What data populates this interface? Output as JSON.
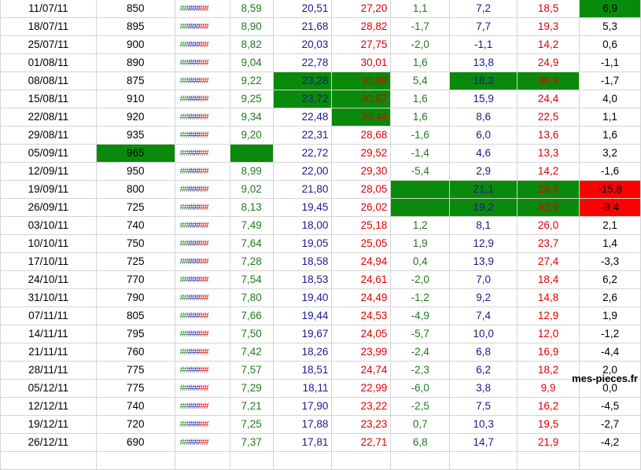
{
  "rows": [
    {
      "date": "11/07/11",
      "val": "850",
      "a": "8,59",
      "b": "20,51",
      "c": "27,20",
      "d": "1,1",
      "e": "7,2",
      "f": "18,5",
      "g": "6,9",
      "hl": {
        "g": "green"
      }
    },
    {
      "date": "18/07/11",
      "val": "895",
      "a": "8,90",
      "b": "21,68",
      "c": "28,82",
      "d": "-1,7",
      "e": "7,7",
      "f": "19,3",
      "g": "5,3",
      "hl": {}
    },
    {
      "date": "25/07/11",
      "val": "900",
      "a": "8,82",
      "b": "20,03",
      "c": "27,75",
      "d": "-2,0",
      "e": "-1,1",
      "f": "14,2",
      "g": "0,6",
      "hl": {}
    },
    {
      "date": "01/08/11",
      "val": "890",
      "a": "9,04",
      "b": "22,78",
      "c": "30,01",
      "d": "1,6",
      "e": "13,8",
      "f": "24,9",
      "g": "-1,1",
      "hl": {}
    },
    {
      "date": "08/08/11",
      "val": "875",
      "a": "9,22",
      "b": "23,28",
      "c": "30,93",
      "d": "5,4",
      "e": "18,3",
      "f": "30,9",
      "g": "-1,7",
      "hl": {
        "b": "green",
        "c": "green",
        "e": "green",
        "f": "green"
      }
    },
    {
      "date": "15/08/11",
      "val": "910",
      "a": "9,25",
      "b": "23,72",
      "c": "30,57",
      "d": "1,6",
      "e": "15,9",
      "f": "24,4",
      "g": "4,0",
      "hl": {
        "b": "green",
        "c": "green"
      }
    },
    {
      "date": "22/08/11",
      "val": "920",
      "a": "9,34",
      "b": "22,48",
      "c": "30,44",
      "d": "1,6",
      "e": "8,6",
      "f": "22,5",
      "g": "1,1",
      "hl": {
        "c": "green"
      }
    },
    {
      "date": "29/08/11",
      "val": "935",
      "a": "9,20",
      "b": "22,31",
      "c": "28,68",
      "d": "-1,6",
      "e": "6,0",
      "f": "13,6",
      "g": "1,6",
      "hl": {}
    },
    {
      "date": "05/09/11",
      "val": "965",
      "a": "9,51",
      "b": "22,72",
      "c": "29,52",
      "d": "-1,4",
      "e": "4,6",
      "f": "13,3",
      "g": "3,2",
      "hl": {
        "val": "green",
        "a": "green"
      }
    },
    {
      "date": "12/09/11",
      "val": "950",
      "a": "8,99",
      "b": "22,00",
      "c": "29,30",
      "d": "-5,4",
      "e": "2,9",
      "f": "14,2",
      "g": "-1,6",
      "hl": {}
    },
    {
      "date": "19/09/11",
      "val": "800",
      "a": "9,02",
      "b": "21,80",
      "c": "28,05",
      "d": "12,7",
      "e": "21,1",
      "f": "29,9",
      "g": "-15,8",
      "hl": {
        "d": "green",
        "e": "green",
        "f": "green",
        "g": "red"
      }
    },
    {
      "date": "26/09/11",
      "val": "725",
      "a": "8,13",
      "b": "19,45",
      "c": "26,02",
      "d": "12,1",
      "e": "19,2",
      "f": "32,9",
      "g": "-9,4",
      "hl": {
        "d": "green",
        "e": "green",
        "f": "green",
        "g": "red"
      }
    },
    {
      "date": "03/10/11",
      "val": "740",
      "a": "7,49",
      "b": "18,00",
      "c": "25,18",
      "d": "1,2",
      "e": "8,1",
      "f": "26,0",
      "g": "2,1",
      "hl": {}
    },
    {
      "date": "10/10/11",
      "val": "750",
      "a": "7,64",
      "b": "19,05",
      "c": "25,05",
      "d": "1,9",
      "e": "12,9",
      "f": "23,7",
      "g": "1,4",
      "hl": {}
    },
    {
      "date": "17/10/11",
      "val": "725",
      "a": "7,28",
      "b": "18,58",
      "c": "24,94",
      "d": "0,4",
      "e": "13,9",
      "f": "27,4",
      "g": "-3,3",
      "hl": {}
    },
    {
      "date": "24/10/11",
      "val": "770",
      "a": "7,54",
      "b": "18,53",
      "c": "24,61",
      "d": "-2,0",
      "e": "7,0",
      "f": "18,4",
      "g": "6,2",
      "hl": {}
    },
    {
      "date": "31/10/11",
      "val": "790",
      "a": "7,80",
      "b": "19,40",
      "c": "24,49",
      "d": "-1,2",
      "e": "9,2",
      "f": "14,8",
      "g": "2,6",
      "hl": {}
    },
    {
      "date": "07/11/11",
      "val": "805",
      "a": "7,66",
      "b": "19,44",
      "c": "24,53",
      "d": "-4,9",
      "e": "7,4",
      "f": "12,9",
      "g": "1,9",
      "hl": {}
    },
    {
      "date": "14/11/11",
      "val": "795",
      "a": "7,50",
      "b": "19,67",
      "c": "24,05",
      "d": "-5,7",
      "e": "10,0",
      "f": "12,0",
      "g": "-1,2",
      "hl": {}
    },
    {
      "date": "21/11/11",
      "val": "760",
      "a": "7,42",
      "b": "18,26",
      "c": "23,99",
      "d": "-2,4",
      "e": "6,8",
      "f": "16,9",
      "g": "-4,4",
      "hl": {}
    },
    {
      "date": "28/11/11",
      "val": "775",
      "a": "7,57",
      "b": "18,51",
      "c": "24,74",
      "d": "-2,3",
      "e": "6,2",
      "f": "18,2",
      "g": "2,0",
      "hl": {}
    },
    {
      "date": "05/12/11",
      "val": "775",
      "a": "7,29",
      "b": "18,11",
      "c": "22,99",
      "d": "-6,0",
      "e": "3,8",
      "f": "9,9",
      "g": "0,0",
      "hl": {}
    },
    {
      "date": "12/12/11",
      "val": "740",
      "a": "7,21",
      "b": "17,90",
      "c": "23,22",
      "d": "-2,5",
      "e": "7,5",
      "f": "16,2",
      "g": "-4,5",
      "hl": {}
    },
    {
      "date": "19/12/11",
      "val": "720",
      "a": "7,25",
      "b": "17,88",
      "c": "23,23",
      "d": "0,7",
      "e": "10,3",
      "f": "19,5",
      "g": "-2,7",
      "hl": {}
    },
    {
      "date": "26/12/11",
      "val": "690",
      "a": "7,37",
      "b": "17,81",
      "c": "22,71",
      "d": "6,8",
      "e": "14,7",
      "f": "21,9",
      "g": "-4,2",
      "hl": {}
    }
  ],
  "indicator_text": "#######",
  "colors": {
    "highlight_green": "#0a8a0a",
    "highlight_red": "#ff0000",
    "text_green": "#1f7a1f",
    "text_blue": "#1a1a8c",
    "text_red": "#e00000"
  },
  "watermark": "mes-pieces.fr"
}
